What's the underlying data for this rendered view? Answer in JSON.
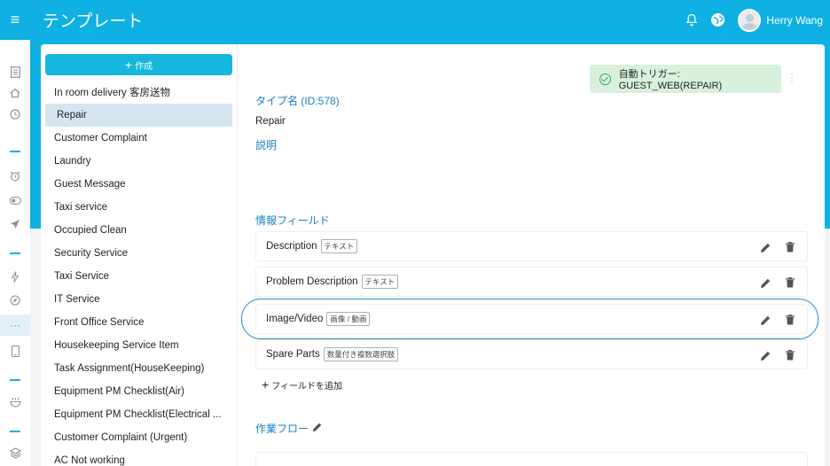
{
  "header": {
    "title": "テンプレート",
    "user_name": "Herry Wang"
  },
  "colors": {
    "brand": "#0fb0e2",
    "selected_row": "#d6e6f1",
    "trigger_bg": "#d9f1dc",
    "link_blue": "#1b7fc1",
    "highlight_outline": "#2a86c5"
  },
  "rail_icons": [
    "list-icon",
    "home-icon",
    "clock-icon",
    "alarm-icon",
    "toggle-icon",
    "send-icon",
    "bolt-icon",
    "compass-icon",
    "more-icon",
    "phone-icon",
    "bowl-icon",
    "layers-icon"
  ],
  "templates": {
    "create_label": "作成",
    "items": [
      "In room delivery 客房送物",
      "Repair",
      "Customer Complaint",
      "Laundry",
      "Guest Message",
      "Taxi service",
      "Occupied Clean",
      "Security Service",
      "Taxi Service",
      "IT Service",
      "Front Office Service",
      "Housekeeping Service Item",
      "Task Assignment(HouseKeeping)",
      "Equipment PM Checklist(Air)",
      "Equipment PM Checklist(Electrical ...",
      "Customer Complaint (Urgent)",
      "AC Not working"
    ],
    "selected": "Repair"
  },
  "detail": {
    "trigger": "自動トリガー: GUEST_WEB(REPAIR)",
    "type_name_label": "タイプ名 (ID:578)",
    "type_name_value": "Repair",
    "description_label": "説明",
    "info_fields_label": "情報フィールド",
    "fields": [
      {
        "name": "Description",
        "type": "テキスト"
      },
      {
        "name": "Problem Description",
        "type": "テキスト"
      },
      {
        "name": "Image/Video",
        "type": "画像 / 動画"
      },
      {
        "name": "Spare Parts",
        "type": "数量付き複数選択肢"
      }
    ],
    "add_field_label": "フィールドを追加",
    "workflow_label": "作業フロー"
  }
}
